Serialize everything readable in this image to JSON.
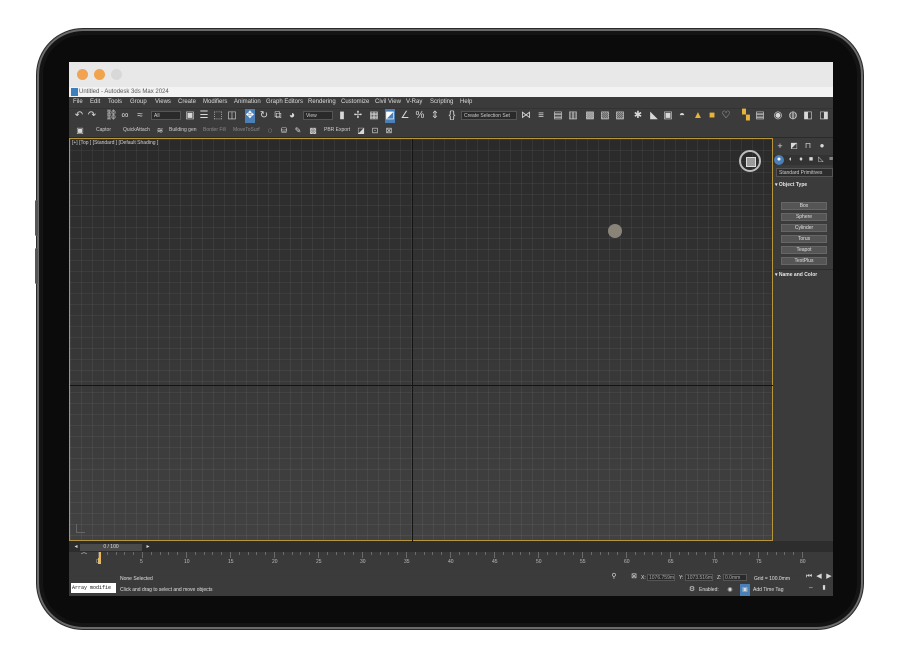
{
  "browser": {
    "colors": {
      "red": "#f2a253",
      "yellow": "#f0a44e",
      "green": "#d8d8d8"
    }
  },
  "window": {
    "title": "Untitled - Autodesk 3ds Max 2024"
  },
  "menu": [
    "File",
    "Edit",
    "Tools",
    "Group",
    "Views",
    "Create",
    "Modifiers",
    "Animation",
    "Graph Editors",
    "Rendering",
    "Customize",
    "Civil View",
    "V-Ray",
    "Scripting",
    "Help"
  ],
  "toolbar": {
    "selection_filter": "All",
    "reference_coord": "View",
    "named_selection": "Create Selection Set"
  },
  "toolbar2": [
    "Captor",
    "QuickAttach",
    "Building gen",
    "Border Fill",
    "MoveToSurf",
    "PBR Export"
  ],
  "viewport": {
    "label": "[+] [Top ] [Standard ] [Default Shading ]"
  },
  "command_panel": {
    "category": "Standard Primitives",
    "object_type_title": "Object Type",
    "primitives": [
      "Box",
      "Sphere",
      "Cylinder",
      "Torus",
      "Teapot",
      "TextPlus"
    ],
    "name_color_title": "Name and Color"
  },
  "timeline": {
    "frame": "0 / 100",
    "ticks": [
      "0",
      "5",
      "10",
      "15",
      "20",
      "25",
      "30",
      "35",
      "40",
      "45",
      "50",
      "55",
      "60",
      "65",
      "70",
      "75",
      "80"
    ]
  },
  "status": {
    "maxscript": "Array modifie",
    "selection": "None Selected",
    "prompt": "Click and drag to select and move objects",
    "x_label": "X:",
    "x_value": "1076.759m",
    "y_label": "Y:",
    "y_value": "1073.516m",
    "z_label": "Z:",
    "z_value": "0.0mm",
    "grid": "Grid = 100.0mm",
    "enabled": "Enabled:",
    "add_time_tag": "Add Time Tag"
  }
}
